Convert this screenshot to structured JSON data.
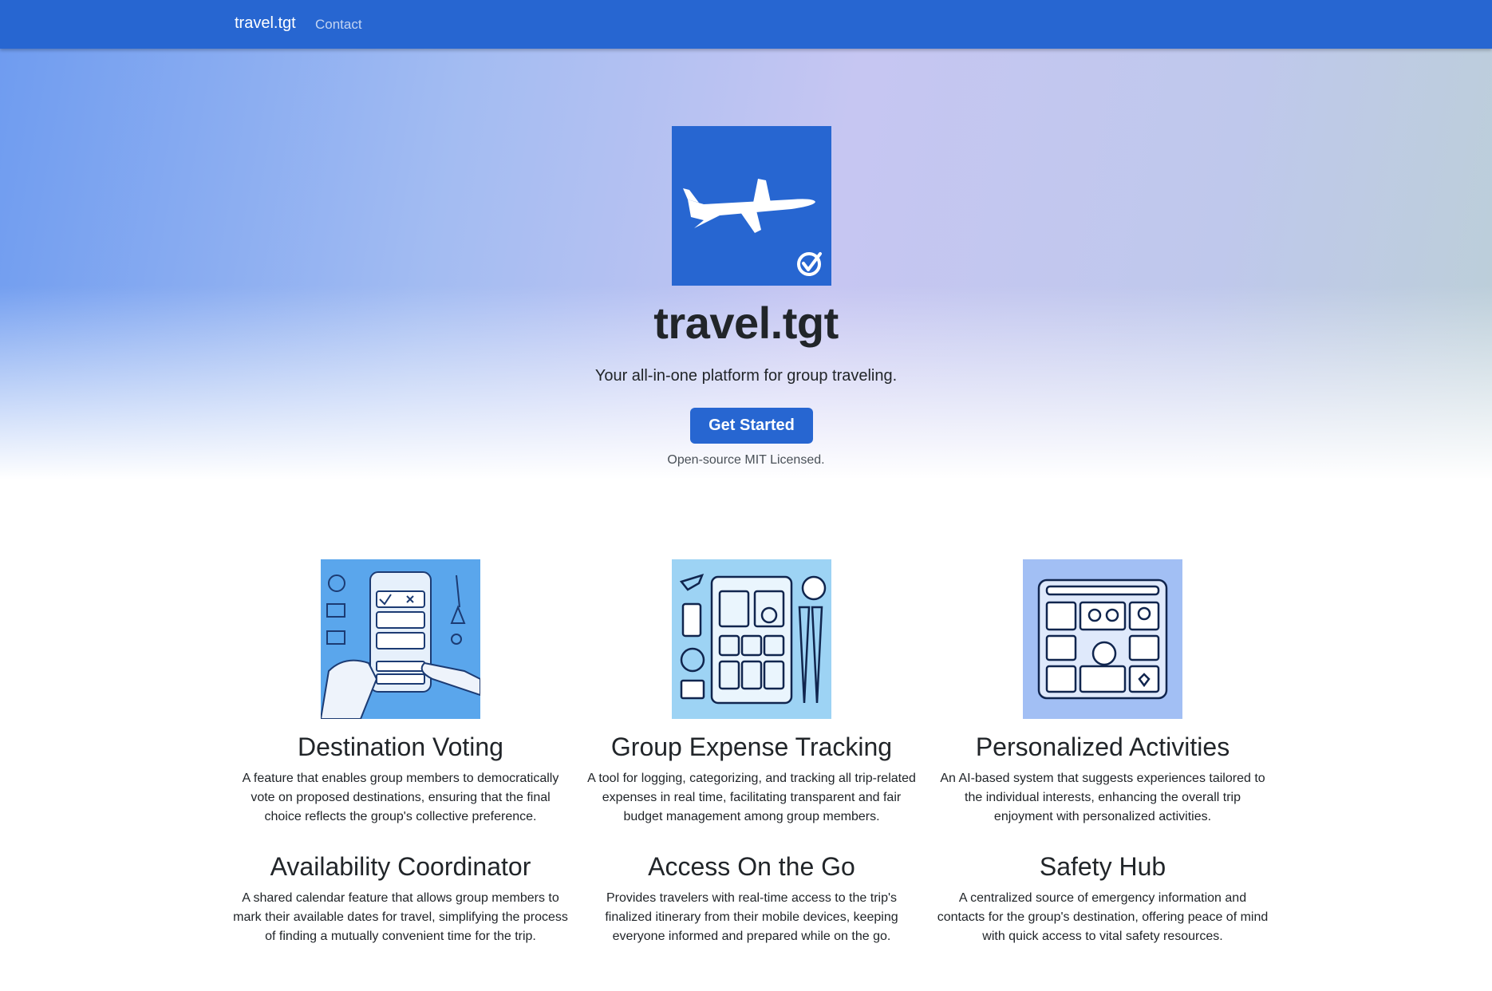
{
  "nav": {
    "brand": "travel.tgt",
    "links": [
      "Contact"
    ]
  },
  "hero": {
    "logo_icon": "airplane-check-logo",
    "title": "travel.tgt",
    "tagline": "Your all-in-one platform for group traveling.",
    "cta_label": "Get Started",
    "license_note": "Open-source MIT Licensed."
  },
  "features": [
    {
      "icon": "voting-illustration",
      "title": "Destination Voting",
      "description": "A feature that enables group members to democratically vote on proposed destinations, ensuring that the final choice reflects the group's collective preference."
    },
    {
      "icon": "expense-tracking-illustration",
      "title": "Group Expense Tracking",
      "description": "A tool for logging, categorizing, and tracking all trip-related expenses in real time, facilitating transparent and fair budget management among group members."
    },
    {
      "icon": "personalized-activities-illustration",
      "title": "Personalized Activities",
      "description": "An AI-based system that suggests experiences tailored to the individual interests, enhancing the overall trip enjoyment with personalized activities."
    },
    {
      "title": "Availability Coordinator",
      "description": "A shared calendar feature that allows group members to mark their available dates for travel, simplifying the process of finding a mutually convenient time for the trip."
    },
    {
      "title": "Access On the Go",
      "description": "Provides travelers with real-time access to the trip's finalized itinerary from their mobile devices, keeping everyone informed and prepared while on the go."
    },
    {
      "title": "Safety Hub",
      "description": "A centralized source of emergency information and contacts for the group's destination, offering peace of mind with quick access to vital safety resources."
    }
  ],
  "colors": {
    "primary": "#2766d1",
    "text": "#212529",
    "muted": "#495057"
  }
}
